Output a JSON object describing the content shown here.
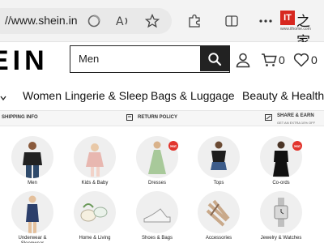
{
  "browser": {
    "url": "//www.shein.in",
    "ithome_char": "之家",
    "ithome_sub": "www.ithome.com",
    "ithome_box": "IT"
  },
  "header": {
    "logo": "EIN",
    "search_value": "Men",
    "cart_count": "0",
    "wishlist_count": "0"
  },
  "categories": [
    "Women Lingerie & Sleep",
    "Bags & Luggage",
    "Beauty & Health"
  ],
  "info_strip": {
    "shipping": "SHIPPING INFO",
    "returns": "RETURN POLICY",
    "share": "SHARE & EARN",
    "share_sub": "GET AN EXTRA 10% OFF"
  },
  "tiles": [
    {
      "label": "Men",
      "hot": false
    },
    {
      "label": "Kids & Baby",
      "hot": false
    },
    {
      "label": "Dresses",
      "hot": true
    },
    {
      "label": "Tops",
      "hot": false
    },
    {
      "label": "Co-ords",
      "hot": true
    },
    {
      "label": "Underwear & Sleepwear",
      "hot": false
    },
    {
      "label": "Home & Living",
      "hot": false
    },
    {
      "label": "Shoes & Bags",
      "hot": false
    },
    {
      "label": "Accessories",
      "hot": false
    },
    {
      "label": "Jewelry & Watches",
      "hot": false
    }
  ],
  "hot_badge": "Hot",
  "colors": {
    "brand_black": "#222222",
    "hot_red": "#e2342d",
    "ithome_red": "#d7271f"
  }
}
